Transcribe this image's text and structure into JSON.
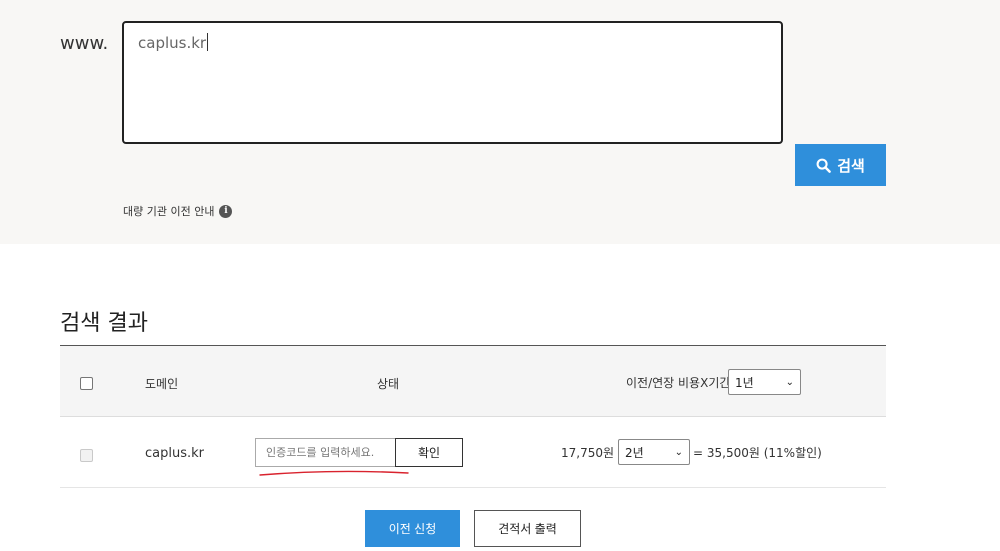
{
  "search": {
    "prefix": "www.",
    "domain_value": "caplus.kr",
    "button_label": "검색",
    "bulk_notice": "대량 기관 이전 안내",
    "info_glyph": "i"
  },
  "results": {
    "title": "검색 결과",
    "headers": {
      "domain": "도메인",
      "status": "상태",
      "cost_period": "이전/연장 비용X기간:"
    },
    "header_period_select": "1년",
    "rows": [
      {
        "domain": "caplus.kr",
        "auth_placeholder": "인증코드를 입력하세요.",
        "confirm_label": "확인",
        "price_prefix": "17,750원 x",
        "period": "2년",
        "price_total": "= 35,500원 (11%할인)"
      }
    ]
  },
  "actions": {
    "transfer_label": "이전 신청",
    "quote_label": "견적서 출력"
  },
  "colors": {
    "accent": "#2f8fdb",
    "panel_bg": "#f8f7f5",
    "annotation_red": "#d9232e"
  }
}
